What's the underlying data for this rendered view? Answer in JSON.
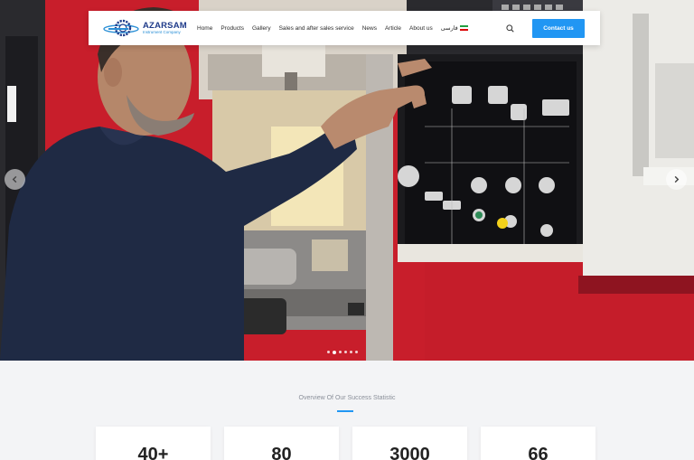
{
  "header": {
    "logo_name": "AZARSAM",
    "logo_sub": "Instrument Company",
    "nav": [
      "Home",
      "Products",
      "Gallery",
      "Sales and after sales service",
      "News",
      "Article",
      "About us"
    ],
    "lang_label": "فارسی",
    "contact_label": "Contact us"
  },
  "icons": {
    "search": "search-icon",
    "prev": "chevron-left-icon",
    "next": "chevron-right-icon",
    "logo": "gear-logo-icon",
    "flag": "iran-flag-icon"
  },
  "colors": {
    "accent": "#2196f3",
    "brand_dark": "#1f3b8a",
    "hero_red": "#c81e2b"
  },
  "slider": {
    "slide_count": 6,
    "active_index": 1
  },
  "stats": {
    "caption": "Overview Of Our Success Statistic",
    "values": [
      "40+",
      "80",
      "3000",
      "66"
    ]
  }
}
